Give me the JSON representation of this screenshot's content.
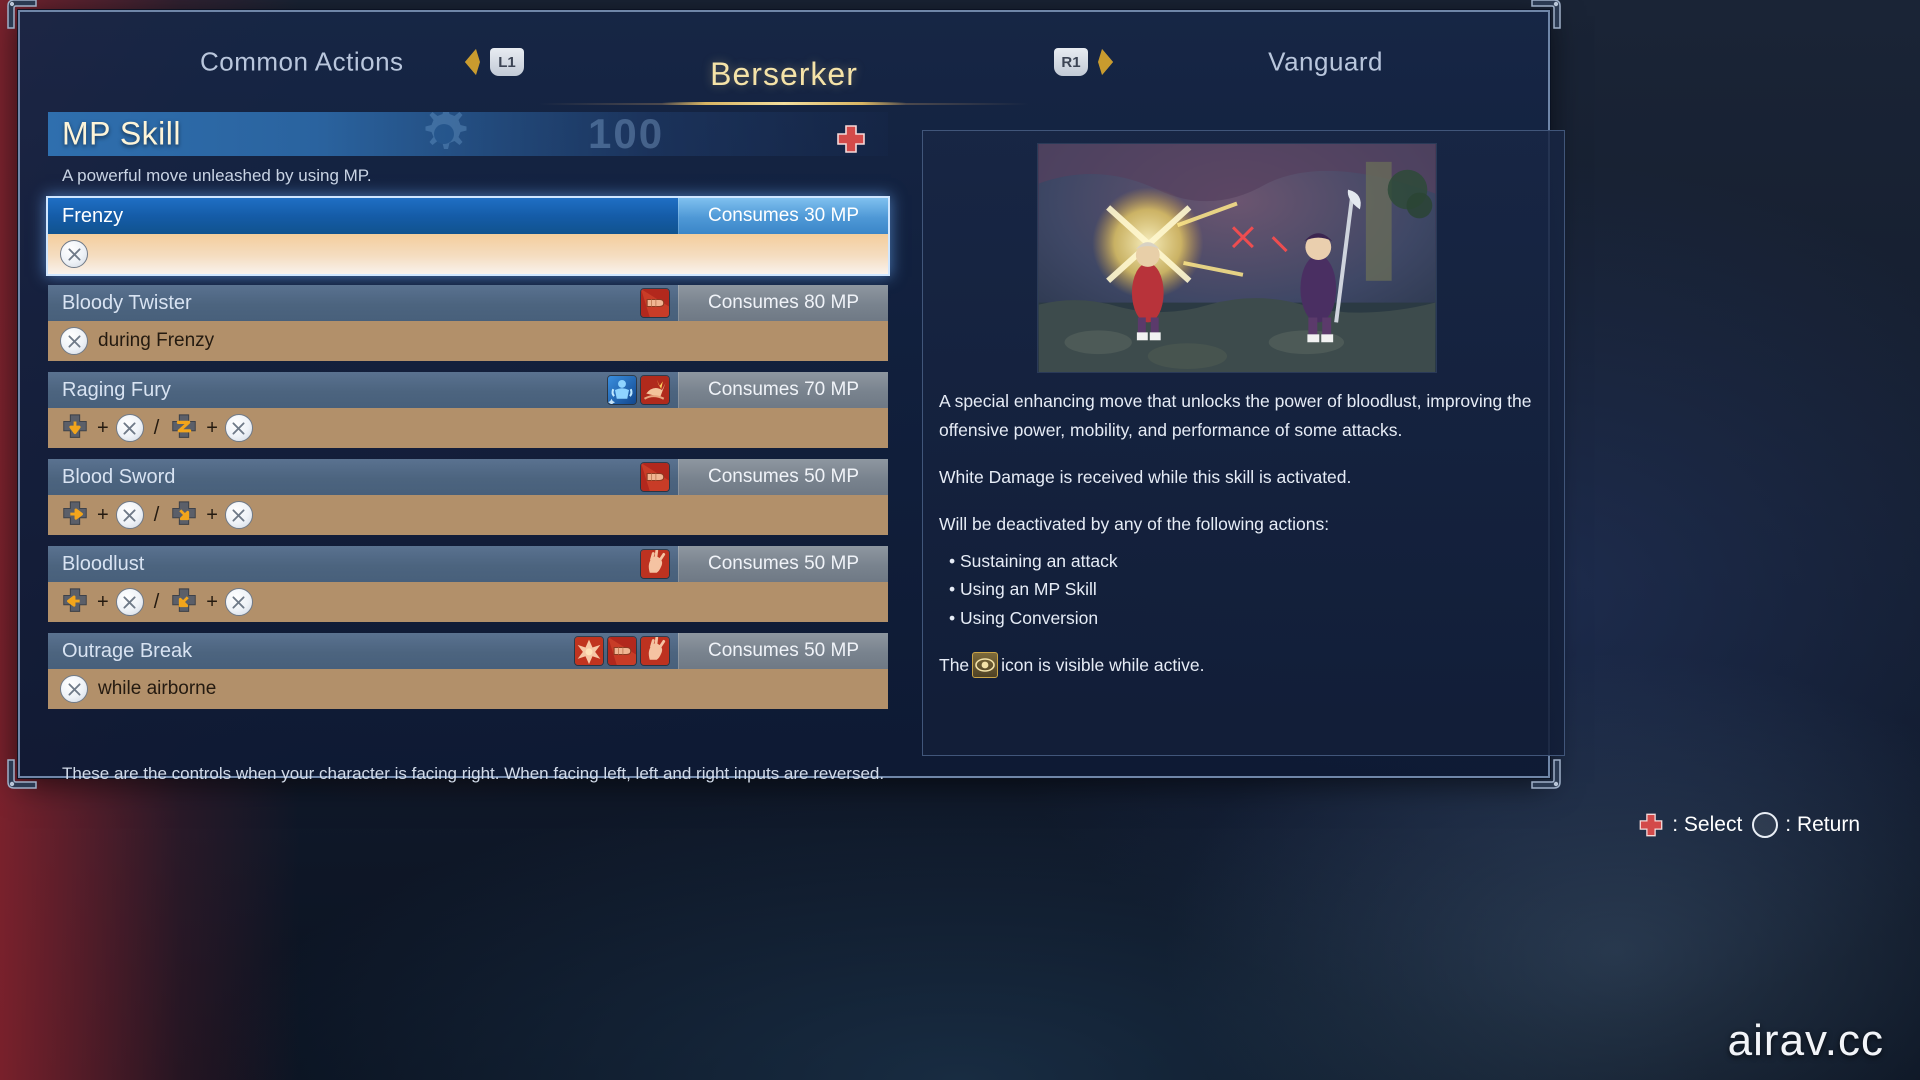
{
  "tabs": {
    "left": {
      "label": "Common Actions",
      "bumper": "L1"
    },
    "center": {
      "label": "Berserker"
    },
    "right": {
      "label": "Vanguard",
      "bumper": "R1"
    }
  },
  "section": {
    "title": "MP Skill",
    "subtitle": "A powerful move unleashed by using MP.",
    "bg_number": "100"
  },
  "skills": [
    {
      "name": "Frenzy",
      "mp": "Consumes 30 MP",
      "icons": [],
      "selected": true,
      "command": {
        "parts": [
          {
            "type": "button",
            "icon": "x-button-icon"
          }
        ],
        "text": ""
      }
    },
    {
      "name": "Bloody Twister",
      "mp": "Consumes 80 MP",
      "icons": [
        "red-fist-icon"
      ],
      "selected": false,
      "command": {
        "parts": [
          {
            "type": "button",
            "icon": "x-button-icon"
          }
        ],
        "text": "during Frenzy"
      }
    },
    {
      "name": "Raging Fury",
      "mp": "Consumes 70 MP",
      "icons": [
        "blue-buff-icon",
        "red-strike-icon"
      ],
      "selected": false,
      "command": {
        "parts": [
          {
            "type": "dpad",
            "dir": "down",
            "icon": "dpad-down-icon"
          },
          {
            "type": "plus",
            "label": "+"
          },
          {
            "type": "button",
            "icon": "x-button-icon"
          },
          {
            "type": "slash",
            "label": "/"
          },
          {
            "type": "dpad",
            "dir": "z",
            "icon": "dpad-zigzag-icon"
          },
          {
            "type": "plus",
            "label": "+"
          },
          {
            "type": "button",
            "icon": "x-button-icon"
          }
        ],
        "text": ""
      }
    },
    {
      "name": "Blood Sword",
      "mp": "Consumes 50 MP",
      "icons": [
        "red-fist-icon"
      ],
      "selected": false,
      "command": {
        "parts": [
          {
            "type": "dpad",
            "dir": "right",
            "icon": "dpad-right-icon"
          },
          {
            "type": "plus",
            "label": "+"
          },
          {
            "type": "button",
            "icon": "x-button-icon"
          },
          {
            "type": "slash",
            "label": "/"
          },
          {
            "type": "dpad",
            "dir": "downright",
            "icon": "dpad-downright-icon"
          },
          {
            "type": "plus",
            "label": "+"
          },
          {
            "type": "button",
            "icon": "x-button-icon"
          }
        ],
        "text": ""
      }
    },
    {
      "name": "Bloodlust",
      "mp": "Consumes 50 MP",
      "icons": [
        "red-claw-icon"
      ],
      "selected": false,
      "command": {
        "parts": [
          {
            "type": "dpad",
            "dir": "left",
            "icon": "dpad-left-icon"
          },
          {
            "type": "plus",
            "label": "+"
          },
          {
            "type": "button",
            "icon": "x-button-icon"
          },
          {
            "type": "slash",
            "label": "/"
          },
          {
            "type": "dpad",
            "dir": "downleft",
            "icon": "dpad-downleft-icon"
          },
          {
            "type": "plus",
            "label": "+"
          },
          {
            "type": "button",
            "icon": "x-button-icon"
          }
        ],
        "text": ""
      }
    },
    {
      "name": "Outrage Break",
      "mp": "Consumes 50 MP",
      "icons": [
        "red-burst-icon",
        "red-fist-icon",
        "red-claw-icon"
      ],
      "selected": false,
      "command": {
        "parts": [
          {
            "type": "button",
            "icon": "x-button-icon"
          }
        ],
        "text": "while airborne"
      }
    }
  ],
  "detail": {
    "paragraphs": [
      "A special enhancing move that unlocks the power of bloodlust, improving the offensive power, mobility, and performance of some attacks.",
      "White Damage is received while this skill is activated.",
      "Will be deactivated by any of the following actions:"
    ],
    "bullets": [
      "• Sustaining an attack",
      "• Using an MP Skill",
      "• Using Conversion"
    ],
    "icon_note_before": "The",
    "icon_note_after": "icon is visible while active."
  },
  "note": "These are the controls when your character is facing right. When facing left, left and right inputs are reversed.",
  "prompts": {
    "select": ": Select",
    "return": ": Return"
  },
  "watermark": "airav.cc",
  "colors": {
    "accent_gold": "#f5e3a8",
    "selected_blue": "#1f6fc4",
    "command_tan": "#b2906a",
    "panel_navy": "#18264a"
  }
}
